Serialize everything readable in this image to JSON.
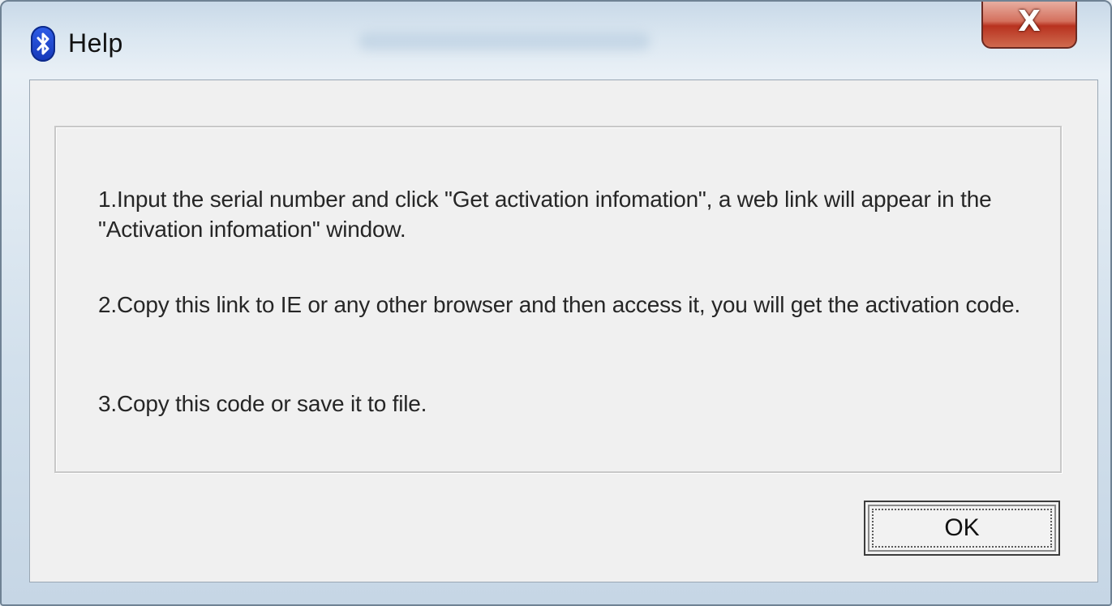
{
  "window": {
    "title": "Help",
    "icon": "bluetooth-icon",
    "close_glyph": "X"
  },
  "content": {
    "paragraphs": [
      "1.Input the serial number and click \"Get activation infomation\", a web link will appear in the \"Activation infomation\" window.",
      "2.Copy this link to IE or any other browser and then access it, you will get the activation code.",
      "3.Copy this code or save it to file."
    ]
  },
  "buttons": {
    "ok_label": "OK"
  },
  "colors": {
    "close_button": "#c8442f",
    "app_icon": "#1f47d0",
    "client_background": "#f0f0f0"
  }
}
